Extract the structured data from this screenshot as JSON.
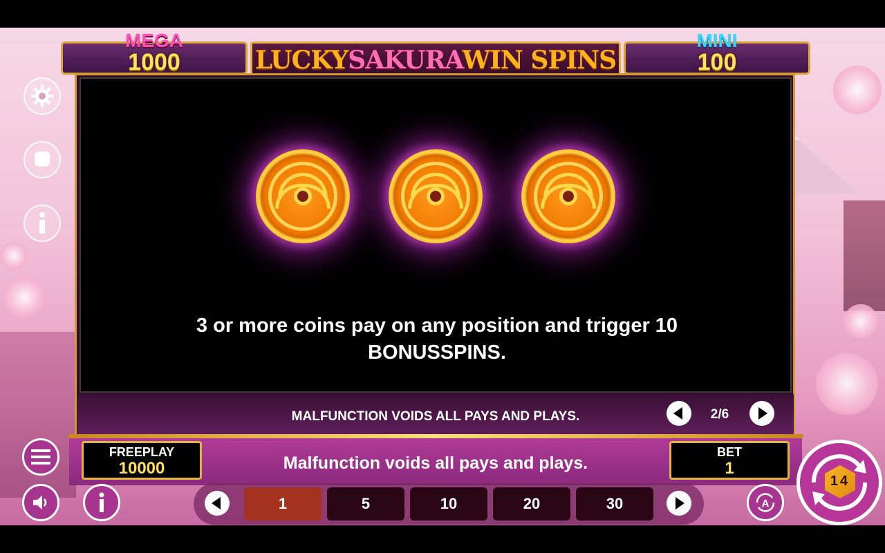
{
  "jackpots": {
    "mega": {
      "label": "MEGA",
      "value": "1000",
      "color": "#ff4fb0"
    },
    "mini": {
      "label": "MINI",
      "value": "100",
      "color": "#35d6ff"
    }
  },
  "title": {
    "part1": "LUCKY",
    "part2": "SAKURA",
    "part3": "WIN SPINS"
  },
  "side_menu": {
    "settings_icon": "gear-icon",
    "coins_icon": "coin-stack-icon",
    "info_icon": "info-icon"
  },
  "paytable": {
    "description": "3 or more coins pay on any position and trigger 10 BONUSSPINS.",
    "disclaimer": "MALFUNCTION VOIDS ALL PAYS AND PLAYS.",
    "page": "2/6",
    "coin_count": 3
  },
  "balance": {
    "label": "FREEPLAY",
    "value": "10000"
  },
  "bet": {
    "label": "BET",
    "value": "1"
  },
  "footer_message": "Malfunction voids all pays and plays.",
  "bet_options": [
    "1",
    "5",
    "10",
    "20",
    "30"
  ],
  "selected_bet_index": 0,
  "spin_badge": {
    "digits": "14"
  },
  "colors": {
    "accent_gold": "#e6b43c",
    "panel_bg": "#000000",
    "pink_bg": "#b33c9a",
    "selected_bet": "#a3321f"
  }
}
